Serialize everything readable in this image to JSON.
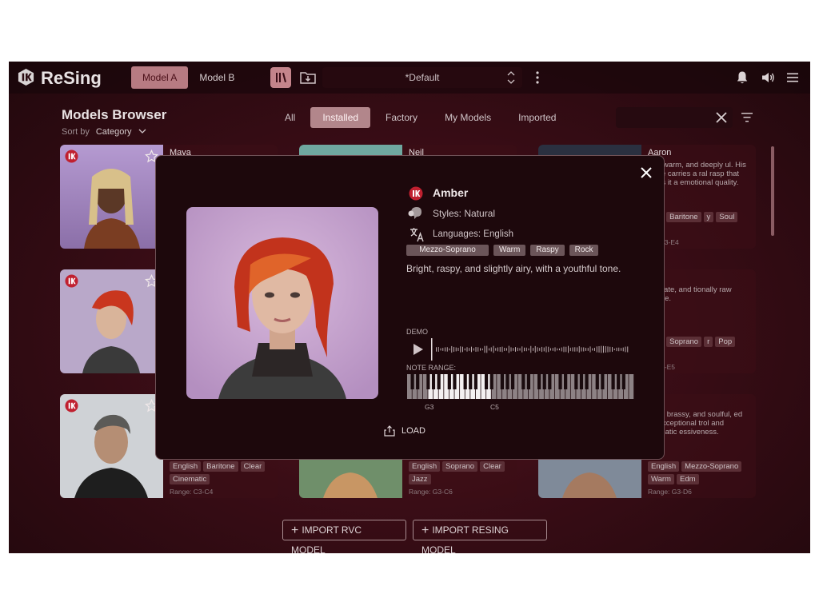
{
  "app": {
    "name": "ReSing",
    "model_tabs": [
      "Model A",
      "Model B"
    ],
    "preset": "*Default"
  },
  "browser": {
    "title": "Models Browser",
    "sort_by_label": "Sort by",
    "sort_by_value": "Category",
    "filters": [
      "All",
      "Installed",
      "Factory",
      "My Models",
      "Imported"
    ],
    "active_filter": "Installed"
  },
  "cards": [
    {
      "name": "Maya",
      "desc": "",
      "tags": [],
      "range": ""
    },
    {
      "name": "Neil",
      "desc": "",
      "tags": [],
      "range": ""
    },
    {
      "name": "Aaron",
      "desc": "elly, warm, and deeply ul. His voice carries a ral rasp that gives it a emotional quality.",
      "tags": [
        "ish",
        "Baritone",
        "y",
        "Soul"
      ],
      "range": "ge: G3-E4"
    },
    {
      "name": "",
      "desc": "",
      "tags": [],
      "range": ""
    },
    {
      "name": "",
      "desc": "",
      "tags": [],
      "range": ""
    },
    {
      "name": "e",
      "desc": "intimate, and tionally raw timbre.",
      "tags": [
        "ish",
        "Soprano",
        "r",
        "Pop"
      ],
      "range": "e: G3-E5"
    },
    {
      "name": "",
      "desc": "",
      "tags": [
        "English",
        "Baritone",
        "Clear",
        "Cinematic"
      ],
      "range": "Range: C3-C4"
    },
    {
      "name": "",
      "desc": "",
      "tags": [
        "English",
        "Soprano",
        "Clear",
        "Jazz"
      ],
      "range": "Range: G3-C6"
    },
    {
      "name": "a",
      "desc": "erful, brassy, and soulful, ed by exceptional trol and dramatic essiveness.",
      "tags": [
        "English",
        "Mezzo-Soprano",
        "Warm",
        "Edm"
      ],
      "range": "Range: G3-D6"
    }
  ],
  "imports": {
    "rvc": "IMPORT RVC MODEL",
    "resing": "IMPORT RESING MODEL"
  },
  "modal": {
    "name": "Amber",
    "styles": "Styles: Natural",
    "languages": "Languages: English",
    "tags": [
      "Mezzo-Soprano",
      "Warm",
      "Raspy",
      "Rock"
    ],
    "description": "Bright, raspy, and slightly airy, with a youthful tone.",
    "demo_label": "DEMO",
    "note_range_label": "NOTE RANGE:",
    "range_low": "G3",
    "range_high": "C5",
    "load_label": "LOAD"
  },
  "colors": {
    "accent": "#c0202f",
    "tab_active": "#b77b82",
    "background": "#3a0d16"
  }
}
